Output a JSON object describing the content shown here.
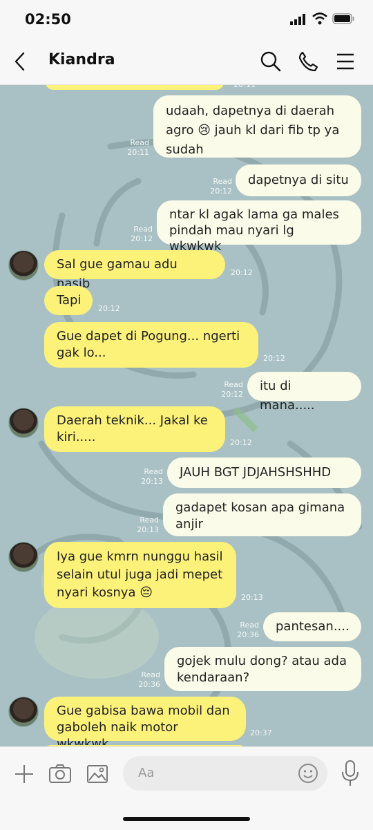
{
  "status": {
    "time": "02:50"
  },
  "header": {
    "title": "Kiandra"
  },
  "messages": [
    {
      "text": "udaah, dapetnya di daerah\nagro 😢 jauh kl dari fib tp ya\nsudah",
      "read": "Read",
      "time": "20:11"
    },
    {
      "text": "dapetnya di situ",
      "read": "Read",
      "time": "20:12"
    },
    {
      "text": "ntar kl agak lama ga males\npindah mau nyari lg wkwkwk",
      "read": "Read",
      "time": "20:12"
    },
    {
      "text": "Sal gue gamau adu nasib",
      "time": "20:12"
    },
    {
      "text": "Tapi",
      "time": "20:12"
    },
    {
      "text": "Gue dapet di Pogung... ngerti\ngak lo...",
      "time": "20:12"
    },
    {
      "text": "itu di mana.....",
      "read": "Read",
      "time": "20:12"
    },
    {
      "text": "Daerah teknik... Jakal ke\nkiri.....",
      "time": "20:12"
    },
    {
      "text": "JAUH BGT JDJAHSHSHHD",
      "read": "Read",
      "time": "20:13"
    },
    {
      "text": "gadapet kosan apa gimana\nanjir",
      "read": "Read",
      "time": "20:13"
    },
    {
      "text": "Iya gue kmrn nunggu hasil\nselain utul juga jadi mepet\nnyari kosnya 😔",
      "time": "20:13"
    },
    {
      "text": "pantesan....",
      "read": "Read",
      "time": "20:36"
    },
    {
      "text": "gojek mulu dong? atau ada\nkendaraan?",
      "read": "Read",
      "time": "20:36"
    },
    {
      "text": "Gue gabisa bawa mobil dan\ngaboleh naik motor wkwkwk",
      "time": "20:37"
    }
  ],
  "input": {
    "placeholder": "Aa"
  },
  "icons": {
    "back": "chevron-left-icon",
    "search": "search-icon",
    "call": "phone-icon",
    "menu": "menu-icon",
    "add": "plus-icon",
    "camera": "camera-icon",
    "image": "image-icon",
    "emoji": "emoji-icon",
    "mic": "microphone-icon"
  },
  "colors": {
    "incoming_bubble": "#fcf27a",
    "outgoing_bubble": "#fbfbe9",
    "chat_background": "#a9c1c4"
  }
}
